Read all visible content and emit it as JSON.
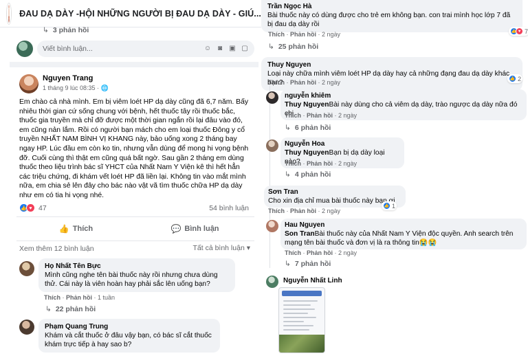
{
  "header": {
    "group_title": "ĐAU DẠ DÀY -HỘI NHỮNG NGƯỜI BỊ ĐAU DẠ DÀY - GIÚ..."
  },
  "left_top": {
    "replies": "3 phản hồi",
    "write_placeholder": "Viết bình luận..."
  },
  "post": {
    "author": "Nguyen Trang",
    "meta": "1 tháng 9 lúc 08:35 · 🌐",
    "body": "Em chào cả nhà mình. Em bị viêm loét HP dạ dày cũng đã 6,7 năm. Bấy nhiêu thời gian cứ sống chung với bệnh, hết thuốc tây rồi thuốc bắc, thuốc gia truyền mà chỉ đỡ được một thời gian ngắn rồi lại đâu vào đó, em cũng nản lắm. Rồi có người bạn mách cho em loại thuốc Đông y cổ truyền NHẤT NAM BÌNH VỊ KHANG này, bảo uống xong 2 tháng bay ngay HP. Lúc đầu em còn ko tin, nhưng vẫn dùng để mong hi vọng bệnh đỡ. Cuối cùng thì thật em cũng quá bất ngờ. Sau gần 2 tháng em dùng thuốc theo liệu trình bác sĩ YHCT của Nhất Nam Y Viện kê thì hết hẳn các triệu chứng, đi khám vết loét HP đã liền lại. Không tin vào mắt mình nữa, em chia sẻ lên đây cho bác nào vật vã tìm thuốc chữa HP dạ dày như em có tia hi vọng nhé.",
    "reaction_count": "47",
    "comment_count": "54 bình luận",
    "like_label": "Thích",
    "comment_label": "Bình luận",
    "see_more": "Xem thêm 12 bình luận",
    "sort_label": "Tất cả bình luận"
  },
  "left_comments": [
    {
      "name": "Họ Nhất Tên Bực",
      "text": "Mình cũng nghe tên bài thuốc này rồi nhưng chưa dùng thử. Cái này là viên hoàn hay phải sắc lên uống bạn?",
      "actions_like": "Thích",
      "actions_reply": "Phản hồi",
      "time": "1 tuần",
      "replies": "22 phản hồi"
    },
    {
      "name": "Phạm Quang Trung",
      "text": "Khám và cắt thuốc ở đâu vậy bạn, có bác sĩ cắt thuốc khám trực tiếp à hay sao b?"
    }
  ],
  "right_comments": {
    "c1": {
      "name": "Trần Ngọc Hà",
      "text": "Bài thuốc này có dùng được cho trẻ em không bạn. con trai mình học lớp 7 đã bị đau dạ dày rồi",
      "like": "Thích",
      "reply": "Phản hồi",
      "time": "2 ngày",
      "react_count": "7",
      "replies": "25 phản hồi"
    },
    "c2": {
      "name": "Thuy Nguyen",
      "text": "Loại này chữa mình viêm loét HP dạ dày hay cả những đạng đau dạ dày khác bạn?",
      "like": "Thích",
      "reply": "Phản hồi",
      "time": "2 ngày",
      "react_count": "2"
    },
    "c3": {
      "name": "nguyễn khiêm",
      "tag": "Thuy Nguyen",
      "text": "Bài này dùng cho cả viêm dạ dày, trào ngược dạ dày nữa đó chị",
      "like": "Thích",
      "reply": "Phản hồi",
      "time": "2 ngày",
      "replies": "6 phản hồi"
    },
    "c4": {
      "name": "Nguyễn Hoa",
      "tag": "Thuy Nguyen",
      "text": "Bạn bị dạ dày loại nào?",
      "like": "Thích",
      "reply": "Phản hồi",
      "time": "2 ngày",
      "replies": "4 phản hồi"
    },
    "c5": {
      "name": "Sơn Tran",
      "text": "Cho xin địa chỉ mua bài thuốc này bạn ơi",
      "like": "Thích",
      "reply": "Phản hồi",
      "time": "2 ngày",
      "react_count": "1"
    },
    "c6": {
      "name": "Hau Nguyen",
      "tag": "Son Tran",
      "text": "Bài thuốc này của Nhất Nam Y Viện độc quyền. Anh search trên mạng tên bài thuốc và đơn vị là ra thông tin😭😭",
      "like": "Thích",
      "reply": "Phản hồi",
      "time": "2 ngày",
      "replies": "7 phản hồi"
    },
    "c7": {
      "name": "Nguyễn Nhất Linh"
    }
  }
}
